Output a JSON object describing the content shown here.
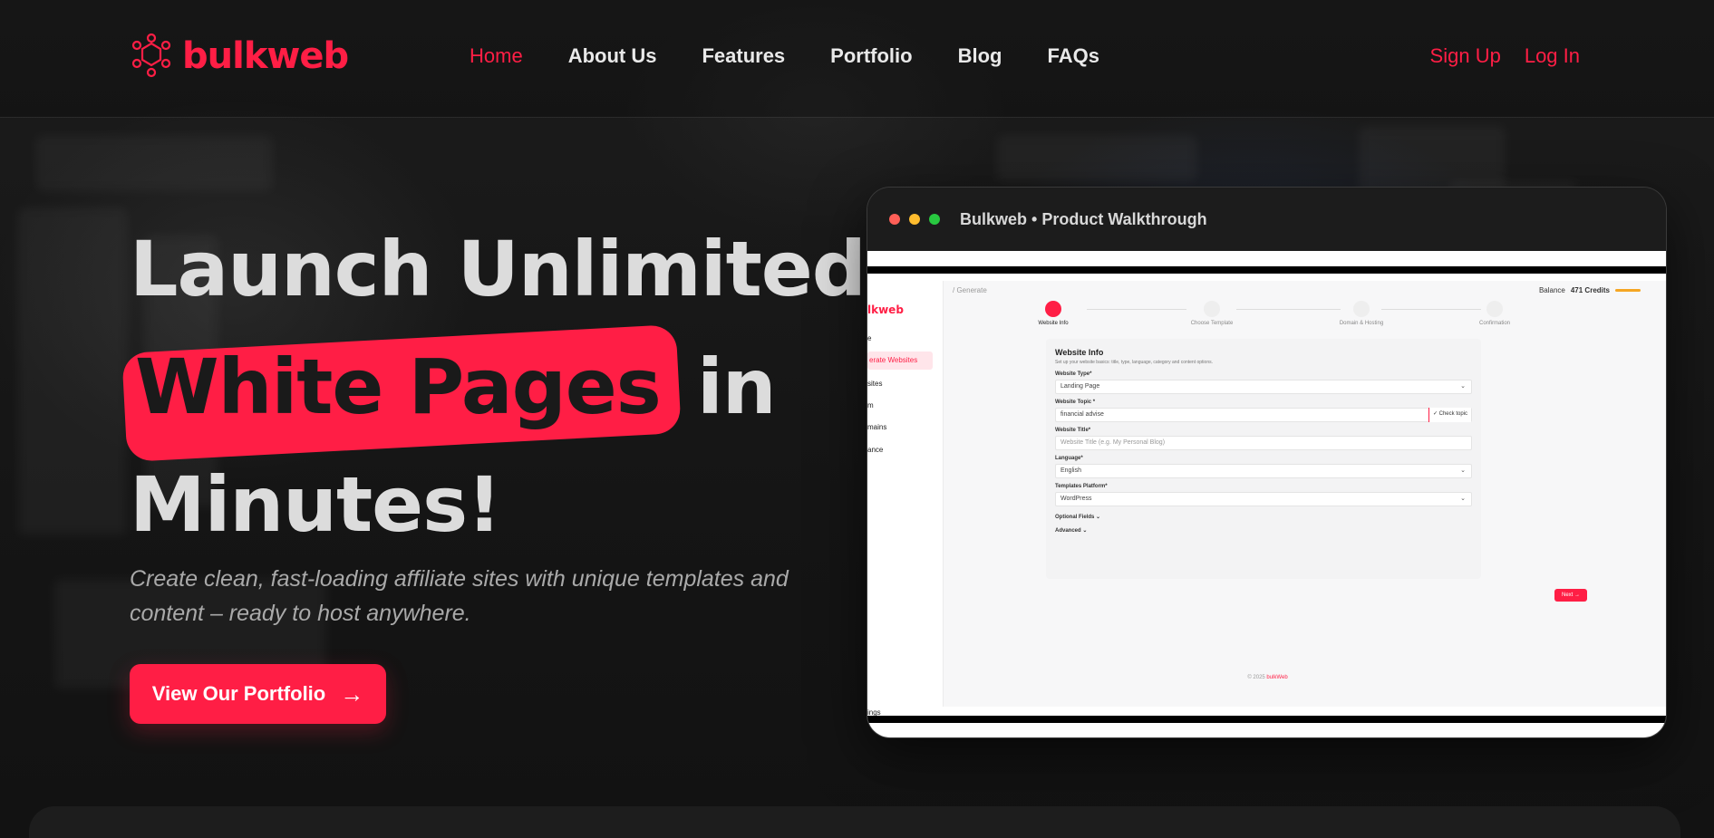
{
  "brand": {
    "name": "bulkweb",
    "accent": "#ff1e45"
  },
  "nav": {
    "items": [
      {
        "label": "Home",
        "active": true
      },
      {
        "label": "About Us",
        "active": false
      },
      {
        "label": "Features",
        "active": false
      },
      {
        "label": "Portfolio",
        "active": false
      },
      {
        "label": "Blog",
        "active": false
      },
      {
        "label": "FAQs",
        "active": false
      }
    ],
    "sign_up": "Sign Up",
    "log_in": "Log In"
  },
  "hero": {
    "title_line1": "Launch Unlimited",
    "title_highlight": "White Pages",
    "title_line2_rest": "in",
    "title_line3": "Minutes!",
    "subtitle": "Create clean, fast-loading affiliate sites with unique templates and content – ready to host anywhere.",
    "cta_label": "View Our Portfolio",
    "cta_icon": "arrow-right-icon"
  },
  "video": {
    "window_title": "Bulkweb • Product Walkthrough",
    "dots": [
      "#ff5f57",
      "#febc2e",
      "#28c840"
    ],
    "app": {
      "brand": "lkweb",
      "sidebar": [
        "e",
        "erate Websites",
        "sites",
        "m",
        "mains",
        "ance",
        "ings"
      ],
      "breadcrumb": "/ Generate",
      "credits_label": "Balance",
      "credits_value": "471 Credits",
      "steps": [
        "Website Info",
        "Choose Template",
        "Domain & Hosting",
        "Confirmation"
      ],
      "form": {
        "title": "Website Info",
        "description": "Set up your website basics: title, type, language, category and content options.",
        "fields": [
          {
            "label": "Website Type*",
            "value": "Landing Page",
            "type": "select"
          },
          {
            "label": "Website Topic *",
            "value": "financial advise",
            "type": "input",
            "action": "Check topic"
          },
          {
            "label": "Website Title*",
            "value": "Website Title (e.g. My Personal Blog)",
            "type": "placeholder"
          },
          {
            "label": "Language*",
            "value": "English",
            "type": "select"
          },
          {
            "label": "Templates Platform*",
            "value": "WordPress",
            "type": "select"
          }
        ],
        "toggles": [
          "Optional Fields",
          "Advanced"
        ]
      },
      "next_label": "Next",
      "footer_prefix": "© 2025",
      "footer_brand": "bulkWeb"
    }
  }
}
